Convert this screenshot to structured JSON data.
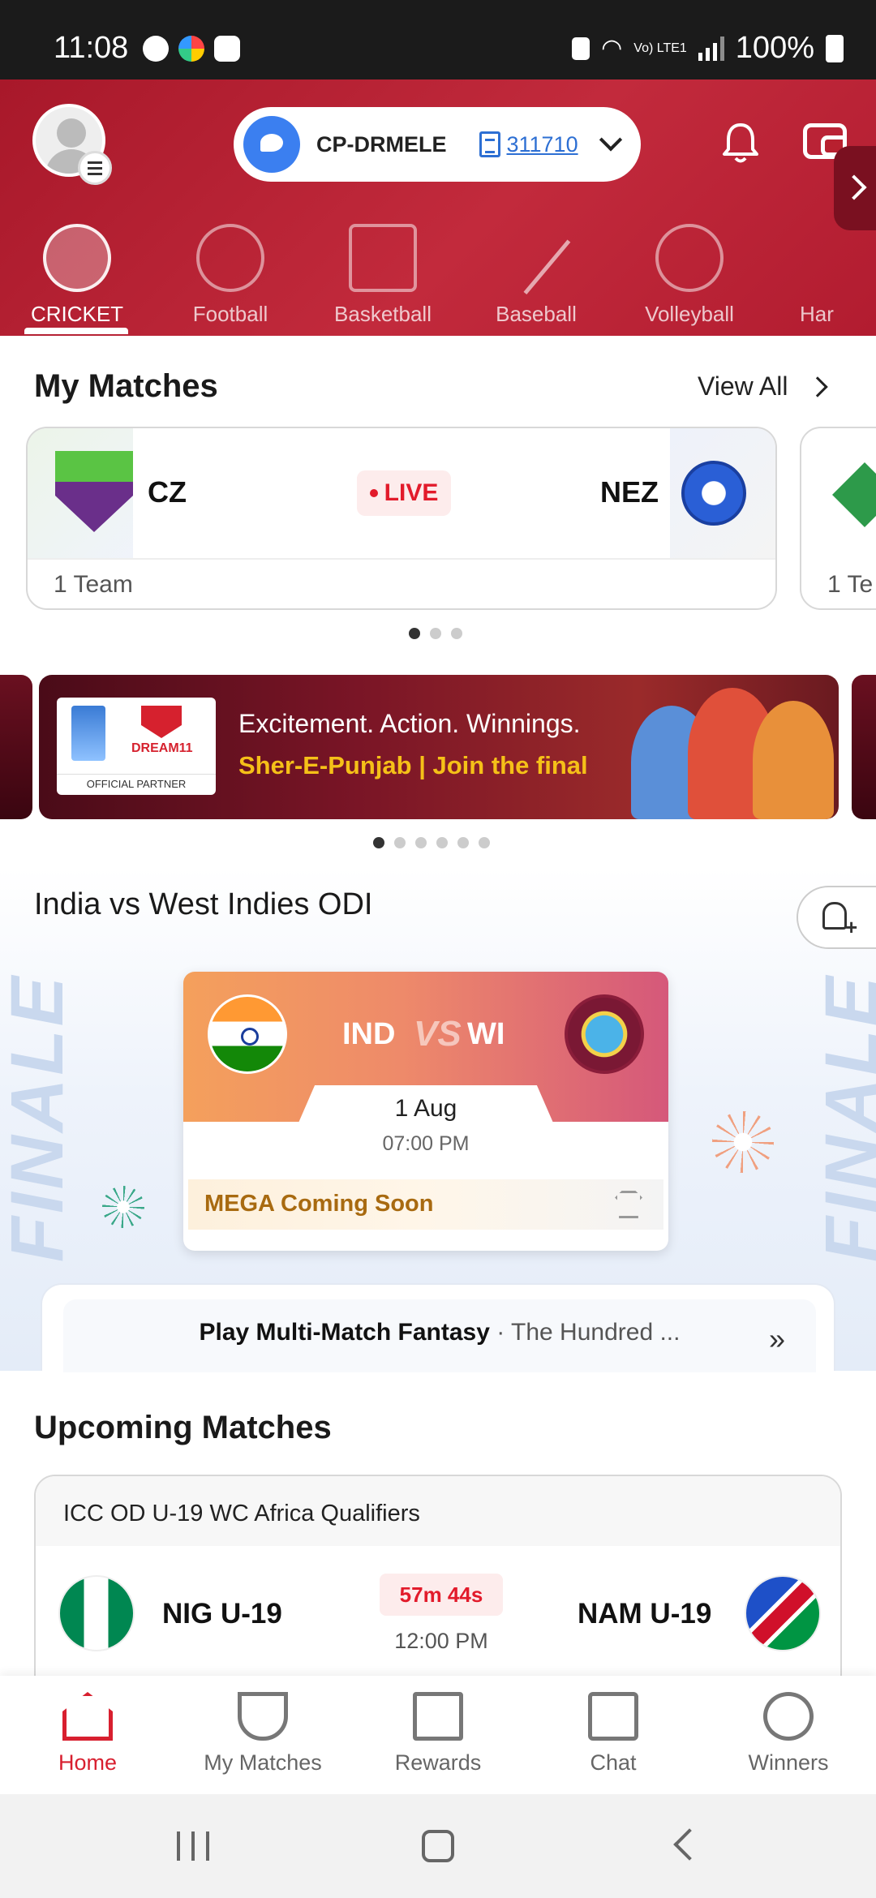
{
  "status_bar": {
    "time": "11:08",
    "network": "Vo) LTE1",
    "battery": "100%"
  },
  "header": {
    "team_name": "CP-DRMELE",
    "team_number": "311710",
    "sport_tabs": [
      {
        "label": "CRICKET",
        "active": true,
        "icon": "cricket-bat-ball-icon"
      },
      {
        "label": "Football",
        "active": false,
        "icon": "football-icon"
      },
      {
        "label": "Basketball",
        "active": false,
        "icon": "basketball-hoop-icon"
      },
      {
        "label": "Baseball",
        "active": false,
        "icon": "baseball-bat-icon"
      },
      {
        "label": "Volleyball",
        "active": false,
        "icon": "volleyball-icon"
      },
      {
        "label": "Har",
        "active": false,
        "icon": "handball-icon"
      }
    ]
  },
  "my_matches": {
    "title": "My Matches",
    "view_all": "View All",
    "cards": [
      {
        "team1": "CZ",
        "team2": "NEZ",
        "status": "LIVE",
        "footer": "1 Team"
      },
      {
        "footer": "1 Te"
      }
    ]
  },
  "banner": {
    "partner_label": "OFFICIAL PARTNER",
    "brand": "DREAM11",
    "line1": "Excitement. Action. Winnings.",
    "line2": "Sher-E-Punjab | Join the final"
  },
  "featured": {
    "title": "India vs West Indies ODI",
    "watermark": "FINALE",
    "team1": "IND",
    "vs": "VS",
    "team2": "WI",
    "date": "1 Aug",
    "time": "07:00 PM",
    "mega": "MEGA",
    "mega_status": "Coming Soon",
    "multi_match_bold": "Play Multi-Match Fantasy",
    "multi_match_sep": " · ",
    "multi_match_rest": "The Hundred ..."
  },
  "upcoming": {
    "title": "Upcoming Matches",
    "league": "ICC OD U-19 WC Africa Qualifiers",
    "team1": "NIG U-19",
    "team2": "NAM U-19",
    "countdown": "57m 44s",
    "time": "12:00 PM"
  },
  "bottom_nav": [
    {
      "label": "Home",
      "active": true,
      "icon": "home-icon"
    },
    {
      "label": "My Matches",
      "active": false,
      "icon": "stadium-icon"
    },
    {
      "label": "Rewards",
      "active": false,
      "icon": "gift-icon"
    },
    {
      "label": "Chat",
      "active": false,
      "icon": "chat-icon"
    },
    {
      "label": "Winners",
      "active": false,
      "icon": "medal-icon"
    }
  ],
  "colors": {
    "brand_red": "#c22a3c",
    "live_red": "#e21b2b",
    "link_blue": "#2d6fd3",
    "mega_gold": "#a86a10",
    "banner_yellow": "#f5c018"
  }
}
